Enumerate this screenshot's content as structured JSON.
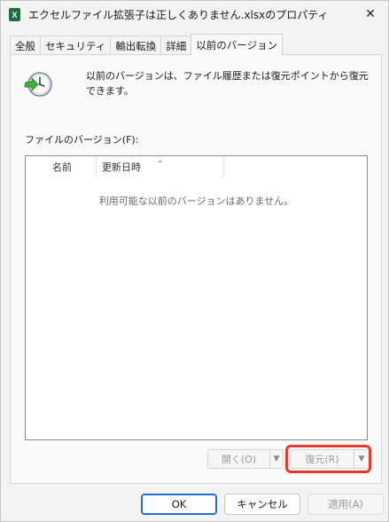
{
  "window": {
    "title": "エクセルファイル拡張子は正しくありません.xlsxのプロパティ",
    "app_icon_letter": "X",
    "close_glyph": "✕"
  },
  "tabs": [
    {
      "label": "全般"
    },
    {
      "label": "セキュリティ"
    },
    {
      "label": "輸出転換"
    },
    {
      "label": "詳細"
    },
    {
      "label": "以前のバージョン"
    }
  ],
  "panel": {
    "description": "以前のバージョンは、ファイル履歴または復元ポイントから復元できます。",
    "versions_label": "ファイルのバージョン(F):",
    "columns": [
      "名前",
      "更新日時"
    ],
    "empty_text": "利用可能な以前のバージョンはありません。",
    "open_button": "開く(O)",
    "restore_button": "復元(R)",
    "dropdown_glyph": "▼",
    "sort_glyph": "⌄"
  },
  "buttons": {
    "ok": "OK",
    "cancel": "キャンセル",
    "apply": "適用(A)"
  },
  "colors": {
    "highlight": "#e53b2e",
    "excel_green": "#1d6f42",
    "default_button_border": "#1f6fcf"
  },
  "icons": {
    "app": "excel-file-icon",
    "close": "close-icon",
    "history": "clock-restore-icon",
    "dropdown": "chevron-down-icon"
  }
}
